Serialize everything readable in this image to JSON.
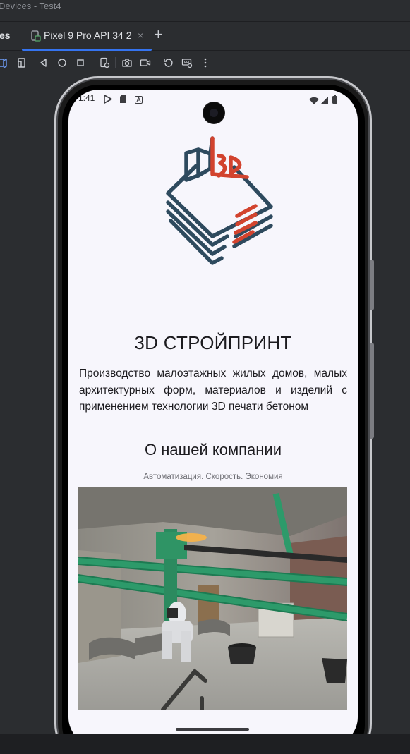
{
  "ide": {
    "window_title": "Devices - Test4",
    "left_tab_label": "es",
    "active_tab": {
      "label": "Pixel 9 Pro API 34 2",
      "close": "×"
    },
    "add_tab": "+",
    "toolbar_icons": [
      "fold-icon",
      "rotate-device-icon",
      "back-icon",
      "home-icon",
      "overview-icon",
      "device-settings-icon",
      "screenshot-icon",
      "screen-record-icon",
      "reset-icon",
      "snapshot-icon",
      "more-icon"
    ],
    "accent": "#3574f0"
  },
  "device": {
    "status_bar": {
      "time": "1:41",
      "icons": [
        "play-store-icon",
        "sd-card-icon",
        "notification-a-icon",
        "wifi-icon",
        "signal-icon",
        "battery-icon"
      ]
    },
    "app": {
      "logo_name": "3D СТРОЙПРИНТ logo",
      "logo_colors": {
        "primary": "#2e4a5e",
        "accent": "#d2432e"
      },
      "logo_text": "3d",
      "title": "3D СТРОЙПРИНТ",
      "description": "Производство малоэтажных жилых домов, малых архитектурных форм, материалов и изделий с применением технологии 3D печати бетоном",
      "about_heading": "О нашей компании",
      "tagline": "Автоматизация. Скорость. Экономия",
      "photo": "3d-concrete-printer-photo"
    }
  }
}
